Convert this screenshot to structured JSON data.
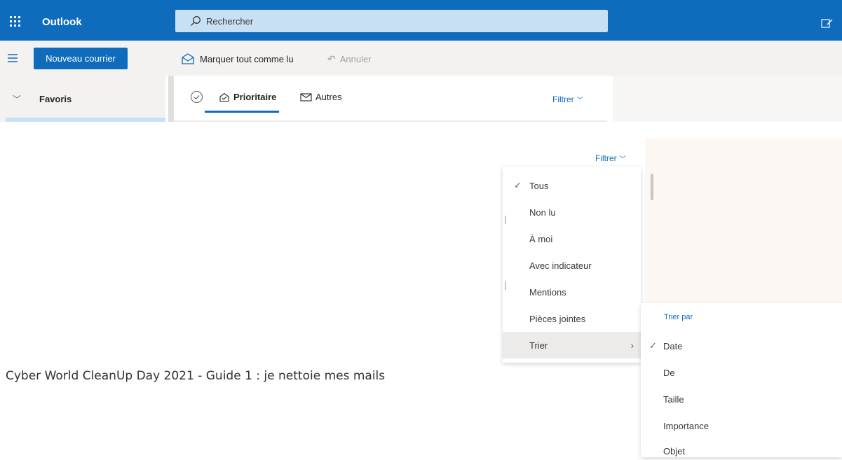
{
  "app": {
    "brand": "Outlook",
    "search_placeholder": "Rechercher"
  },
  "toolbar": {
    "new_mail_label": "Nouveau courrier",
    "mark_all_read_label": "Marquer tout comme lu",
    "undo_label": "Annuler"
  },
  "sidebar": {
    "favorites_label": "Favoris"
  },
  "list_header": {
    "tabs": [
      {
        "label": "Prioritaire",
        "selected": true
      },
      {
        "label": "Autres",
        "selected": false
      }
    ],
    "filter_label": "Filtrer"
  },
  "filter_menu": {
    "button_label": "Filtrer",
    "items": [
      {
        "label": "Tous",
        "checked": true
      },
      {
        "label": "Non lu",
        "checked": false
      },
      {
        "label": "À moi",
        "checked": false
      },
      {
        "label": "Avec indicateur",
        "checked": false
      },
      {
        "label": "Mentions",
        "checked": false
      },
      {
        "label": "Pièces jointes",
        "checked": false
      },
      {
        "label": "Trier",
        "checked": false,
        "has_submenu": true
      }
    ]
  },
  "sort_menu": {
    "header": "Trier par",
    "items": [
      {
        "label": "Date",
        "checked": true
      },
      {
        "label": "De",
        "checked": false
      },
      {
        "label": "Taille",
        "checked": false
      },
      {
        "label": "Importance",
        "checked": false
      },
      {
        "label": "Objet",
        "checked": false
      }
    ]
  },
  "caption": "Cyber World CleanUp Day 2021 - Guide 1 : je nettoie mes mails",
  "colors": {
    "brand_blue": "#0f6cbd",
    "search_bg": "#c7e0f4",
    "command_bar_bg": "#f3f2f1"
  }
}
